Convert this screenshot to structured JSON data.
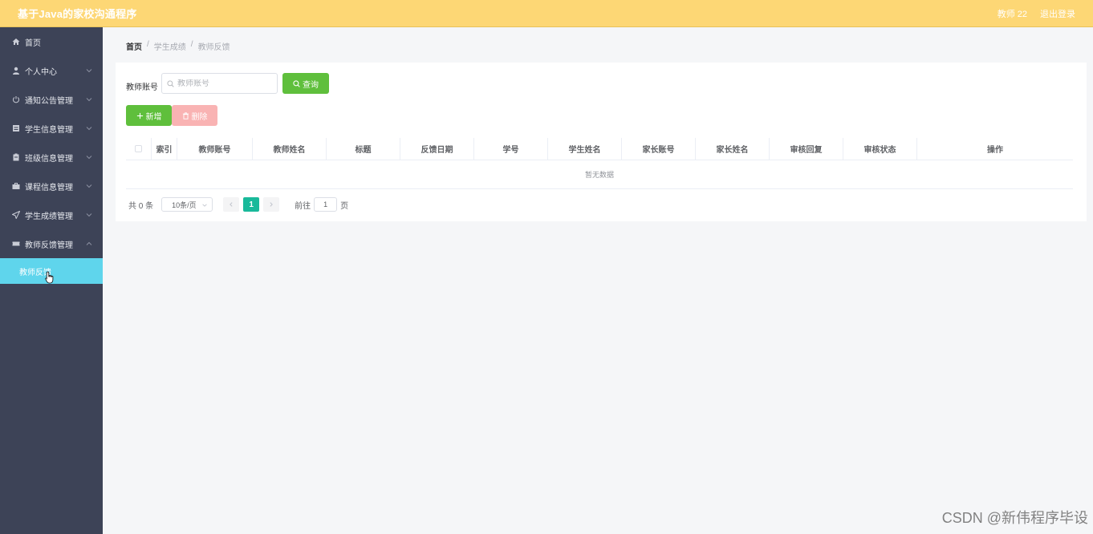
{
  "header": {
    "title": "基于Java的家校沟通程序",
    "user": "教师 22",
    "logout": "退出登录"
  },
  "sidebar": {
    "items": [
      {
        "label": "首页",
        "icon": "home-icon"
      },
      {
        "label": "个人中心",
        "icon": "user-icon"
      },
      {
        "label": "通知公告管理",
        "icon": "power-icon"
      },
      {
        "label": "学生信息管理",
        "icon": "list-icon"
      },
      {
        "label": "班级信息管理",
        "icon": "clipboard-icon"
      },
      {
        "label": "课程信息管理",
        "icon": "briefcase-icon"
      },
      {
        "label": "学生成绩管理",
        "icon": "send-icon"
      },
      {
        "label": "教师反馈管理",
        "icon": "ticket-icon"
      }
    ],
    "active_sub": "教师反馈"
  },
  "breadcrumb": {
    "items": [
      "首页",
      "学生成绩",
      "教师反馈"
    ],
    "separator": "/"
  },
  "search": {
    "label": "教师账号",
    "placeholder": "教师账号",
    "button": "查询"
  },
  "actions": {
    "add": "新增",
    "delete": "删除"
  },
  "table": {
    "columns": [
      "索引",
      "教师账号",
      "教师姓名",
      "标题",
      "反馈日期",
      "学号",
      "学生姓名",
      "家长账号",
      "家长姓名",
      "审核回复",
      "审核状态",
      "操作"
    ],
    "empty_text": "暂无数据"
  },
  "pagination": {
    "total": "共 0 条",
    "page_size": "10条/页",
    "current": "1",
    "goto_prefix": "前往",
    "goto_value": "1",
    "goto_suffix": "页"
  },
  "watermark": "CSDN @新伟程序毕设"
}
